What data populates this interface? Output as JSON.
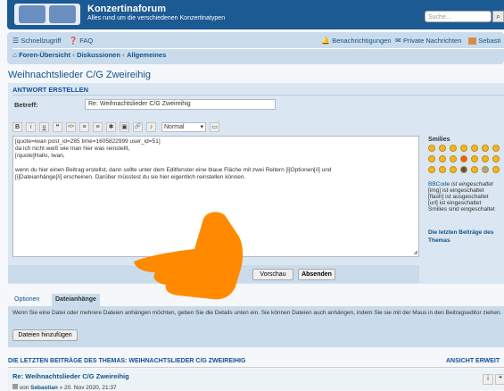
{
  "header": {
    "site_title": "Konzertinaforum",
    "site_description": "Alles rund um die verschiedenen Konzertinatypen",
    "search_placeholder": "Suche…"
  },
  "navbar": {
    "quicklinks": "Schnellzugriff",
    "faq": "FAQ",
    "notifications": "Benachrichtigungen",
    "private_messages": "Private Nachrichten",
    "user": "Sebasti",
    "breadcrumbs": [
      "Foren-Übersicht",
      "Diskussionen",
      "Allgemeines"
    ]
  },
  "page_title": "Weihnachtslieder C/G Zweireihig",
  "post_form": {
    "heading": "ANTWORT ERSTELLEN",
    "subject_label": "Betreff:",
    "subject_value": "Re: Weihnachtslieder C/G Zweireihig",
    "toolbar": [
      "B",
      "i",
      "u",
      "❝",
      "</>",
      "≡",
      "≡",
      "✱",
      "▣",
      "🔗",
      "♪"
    ],
    "font_size": "Normal",
    "message_lines": [
      "[quote=iwan post_id=285 time=1605822999 user_id=51]",
      "da ich nicht weiß wie man hier was reinstellt,",
      "[/quote]Hallo, Iwan,",
      "",
      "wenn du hier einen Beitrag erstellst, dann sollte unter dem Editfenster eine blaue Fläche mit zwei Reitern [i]Optionen[/i] und",
      "[i]Dateianhänge[/i] erscheinen. Darüber müsstest du sie hier eigentlich reinstellen können."
    ],
    "smilies_title": "Smilies",
    "bbcode_info": [
      {
        "link": "BBCode",
        "text": " ist eingeschaltet"
      },
      {
        "link": "",
        "text": "[img] ist eingeschaltet"
      },
      {
        "link": "",
        "text": "[flash] ist ausgeschaltet"
      },
      {
        "link": "",
        "text": "[url] ist eingeschaltet"
      },
      {
        "link": "",
        "text": "Smilies sind eingeschaltet"
      }
    ],
    "last_posts_sidebar": "Die letzten Beiträge des Themas",
    "preview_button": "Vorschau",
    "submit_button": "Absenden"
  },
  "tabs": [
    "Optionen",
    "Dateianhänge"
  ],
  "attachments": {
    "help_text": "Wenn Sie eine Datei oder mehrere Dateien anhängen möchten, geben Sie die Details unten ein. Sie können Dateien auch anhängen, indem Sie sie mit der Maus in den Beitragseditor ziehen.",
    "add_button": "Dateien hinzufügen"
  },
  "last_posts": {
    "title": "DIE LETZTEN BEITRÄGE DES THEMAS: WEIHNACHTSLIEDER C/G ZWEIREIHIG",
    "expand_link": "ANSICHT ERWEIT",
    "post_title": "Re: Weihnachtslieder C/G Zweireihig",
    "post_meta_prefix": "von",
    "post_author": "Sebastian",
    "post_date": "» 20. Nov 2020, 21:37"
  },
  "colors": {
    "header": "#1c5a93",
    "navbar": "#cadceb",
    "panel": "#dae6f1",
    "link": "#105289",
    "cursor": "#ff8a00"
  }
}
